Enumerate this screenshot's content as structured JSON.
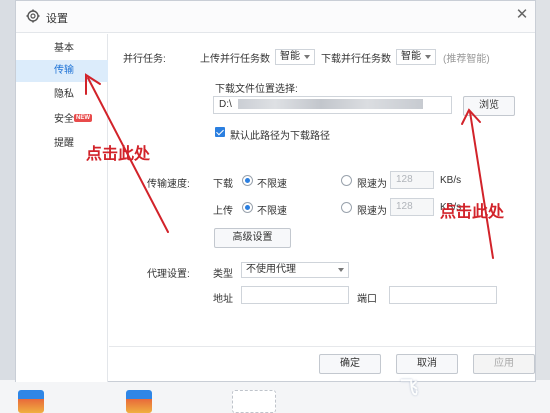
{
  "window": {
    "title": "设置",
    "close_glyph": "✕"
  },
  "sidebar": {
    "items": [
      {
        "label": "基本",
        "active": false
      },
      {
        "label": "传输",
        "active": true
      },
      {
        "label": "隐私",
        "active": false
      },
      {
        "label": "安全",
        "active": false,
        "badge": "NEW"
      },
      {
        "label": "提醒",
        "active": false
      }
    ]
  },
  "parallel": {
    "label": "并行任务:",
    "upload_label": "上传并行任务数",
    "upload_value": "智能",
    "download_label": "下载并行任务数",
    "download_value": "智能",
    "hint": "(推荐智能)"
  },
  "download_location": {
    "label": "下载文件位置选择:",
    "path_prefix": "D:\\",
    "browse_label": "浏览",
    "default_checkbox_label": "默认此路径为下载路径",
    "default_checked": true
  },
  "speed": {
    "label": "传输速度:",
    "download": {
      "label": "下载",
      "unlimited_label": "不限速",
      "limit_label": "限速为",
      "limit_value": "128",
      "unit": "KB/s",
      "selected": "unlimited"
    },
    "upload": {
      "label": "上传",
      "unlimited_label": "不限速",
      "limit_label": "限速为",
      "limit_value": "128",
      "unit": "KB/s",
      "selected": "unlimited"
    },
    "advanced_button": "高级设置"
  },
  "proxy": {
    "label": "代理设置:",
    "type_label": "类型",
    "type_value": "不使用代理",
    "address_label": "地址",
    "address_value": "",
    "port_label": "端口",
    "port_value": ""
  },
  "footer": {
    "ok": "确定",
    "cancel": "取消",
    "apply": "应用"
  },
  "annotations": {
    "left_text": "点击此处",
    "right_text": "点击此处",
    "color": "#d2232a"
  },
  "accent_color": "#2b7fe0",
  "watermark": "飞"
}
